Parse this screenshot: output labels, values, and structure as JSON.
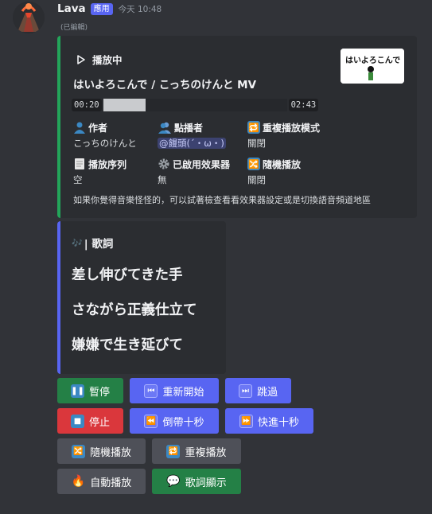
{
  "message": {
    "bot_name": "Lava",
    "app_badge": "應用",
    "timestamp": "今天 10:48",
    "edited": "(已編輯)"
  },
  "now_playing": {
    "heading": "播放中",
    "song_title": "はいよろこんで / こっちのけんと MV",
    "progress": {
      "current": "00:20",
      "total": "02:43",
      "fraction": 0.12
    },
    "thumbnail_text": "はいよろこんで",
    "fields": [
      {
        "icon": "bust-silhouette-icon",
        "name": "作者",
        "value": "こっちのけんと"
      },
      {
        "icon": "busts-silhouette-icon",
        "name": "點播者",
        "value": "@饅頭(´・ω・)"
      },
      {
        "icon": "repeat-icon",
        "name": "重複播放模式",
        "value": "關閉"
      },
      {
        "icon": "page-icon",
        "name": "播放序列",
        "value": "空"
      },
      {
        "icon": "gear-icon",
        "name": "已啟用效果器",
        "value": "無"
      },
      {
        "icon": "shuffle-icon",
        "name": "隨機播放",
        "value": "關閉"
      }
    ],
    "note": "如果你覺得音樂怪怪的，可以試著檢查看看效果器設定或是切換語音頻道地區"
  },
  "lyrics": {
    "heading": "| 歌詞",
    "lines": [
      "差し伸びてきた手",
      "さながら正義仕立て",
      "嫌嫌で生き延びて"
    ]
  },
  "buttons": {
    "pause": "暫停",
    "restart": "重新開始",
    "skip": "跳過",
    "stop": "停止",
    "rewind": "倒帶十秒",
    "forward": "快進十秒",
    "shuffle": "隨機播放",
    "repeat": "重複播放",
    "autoplay": "自動播放",
    "show_lyrics": "歌詞顯示"
  },
  "colors": {
    "background": "#313338",
    "embed": "#2b2d31",
    "accent_green": "#23a55a",
    "blurple": "#5865f2",
    "danger": "#da373c"
  }
}
